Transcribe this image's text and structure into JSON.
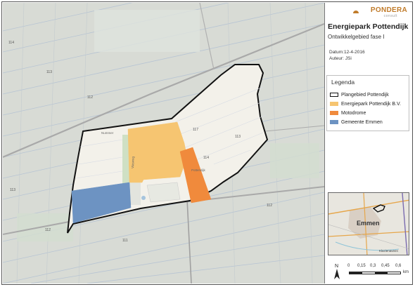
{
  "logo": {
    "name": "PONDERA",
    "sub": "consult"
  },
  "title": "Energiepark Pottendijk",
  "subtitle": "Ontwikkelgebied fase I",
  "meta": {
    "date": "Datum:12-4-2016",
    "author": "Auteur: JSi"
  },
  "legend": {
    "title": "Legenda",
    "items": [
      {
        "label": "Plangebied Pottendijk",
        "fill": "#ffffff",
        "stroke": "#111111"
      },
      {
        "label": "Energiepark Pottendijk B.V.",
        "fill": "#f6c571",
        "stroke": "#f6c571"
      },
      {
        "label": "Motodrome",
        "fill": "#f08a3c",
        "stroke": "#f08a3c"
      },
      {
        "label": "Gemeente Emmen",
        "fill": "#6d93c2",
        "stroke": "#6d93c2"
      }
    ]
  },
  "inset": {
    "city": "Emmen",
    "place": "Klazienaveen"
  },
  "scale": {
    "ticks": [
      "0",
      "0,15",
      "0,3",
      "0,45",
      "0,6"
    ],
    "unit": "km"
  },
  "north": "N",
  "map_labels": {
    "parcel_numbers": [
      "114",
      "113",
      "112",
      "113",
      "112",
      "111",
      "117",
      "114",
      "113",
      "112"
    ],
    "road_names": [
      "Nummer",
      "Vlasweg"
    ],
    "area_label": "Pottendijk"
  },
  "colors": {
    "map_bg": "#d9dcd6",
    "plangebied_fill": "#f3f1ea",
    "energiepark": "#f6c571",
    "motodrome": "#f08a3c",
    "gemeente": "#6d93c2",
    "inset_bg": "#e5e3dc"
  }
}
